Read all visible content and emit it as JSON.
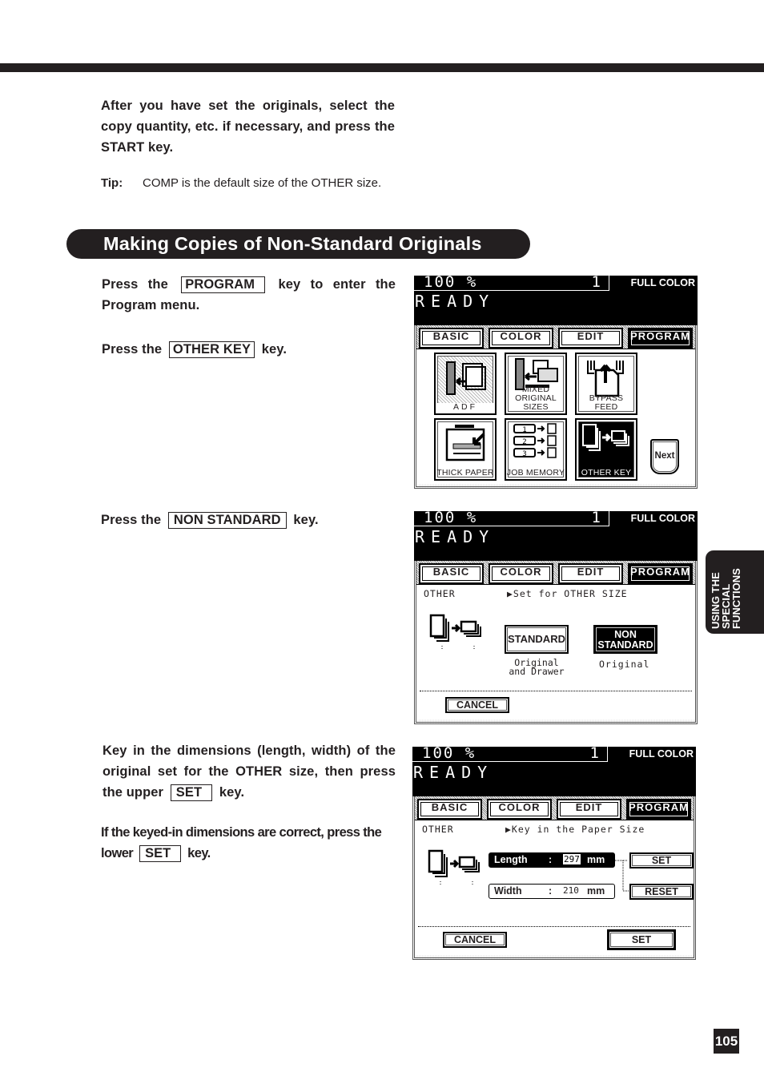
{
  "page": {
    "intro_text": "After you have set the originals, select the copy quantity, etc. if necessary, and press the START key.",
    "tip_label": "Tip:",
    "tip_text": "COMP is the default size of the OTHER size.",
    "section_title": "Making Copies of Non-Standard Originals",
    "side_tab": [
      "USING THE",
      "SPECIAL",
      "FUNCTIONS"
    ],
    "page_number": "105"
  },
  "steps": [
    {
      "pre": "Press the",
      "key": "PROGRAM",
      "post": "key to enter the Program menu."
    },
    {
      "pre": "Press the",
      "key": "OTHER KEY",
      "post": "key."
    },
    {
      "pre": "Press the",
      "key": "NON STANDARD",
      "post": "key."
    },
    {
      "pre": "Key in the dimensions (length, width) of the original set for the OTHER size, then press the upper",
      "key": "SET",
      "post": "key."
    },
    {
      "pre": "If the keyed-in dimensions are correct, press the lower",
      "key": "SET",
      "post": "key."
    }
  ],
  "screen_common": {
    "zoom": "100 %",
    "quantity": "1",
    "mode": "FULL COLOR",
    "status": "READY",
    "tabs": [
      "BASIC",
      "COLOR",
      "EDIT",
      "PROGRAM"
    ],
    "active_tab": "PROGRAM"
  },
  "screen1": {
    "icons": [
      {
        "label": "ADF",
        "icon": "adf-icon"
      },
      {
        "label": "MIXED ORIGINAL SIZES",
        "label_top": "MIXED",
        "label_bottom": "ORIGINAL SIZES",
        "icon": "mixed-sizes-icon"
      },
      {
        "label": "BYPASS FEED",
        "icon": "bypass-feed-icon"
      },
      {
        "label": "THICK PAPER",
        "icon": "thick-paper-icon"
      },
      {
        "label": "JOB MEMORY",
        "icon": "job-memory-icon",
        "numbers": [
          "1",
          "2",
          "3"
        ]
      },
      {
        "label": "OTHER KEY",
        "icon": "other-key-icon",
        "selected": true
      }
    ],
    "next_label": "Next"
  },
  "screen2": {
    "mode_label": "OTHER",
    "instruction": "▶Set for OTHER SIZE",
    "standard_label": "STANDARD",
    "standard_caption": [
      "Original",
      "and Drawer"
    ],
    "nonstandard_label": [
      "NON",
      "STANDARD"
    ],
    "nonstandard_caption": "Original",
    "cancel_label": "CANCEL"
  },
  "screen3": {
    "mode_label": "OTHER",
    "instruction": "▶Key in the Paper Size",
    "length_label": "Length",
    "length_value": "297",
    "width_label": "Width",
    "width_value": "210",
    "colon": ":",
    "unit": "mm",
    "set_label": "SET",
    "reset_label": "RESET",
    "cancel_label": "CANCEL",
    "bottom_set_label": "SET"
  }
}
